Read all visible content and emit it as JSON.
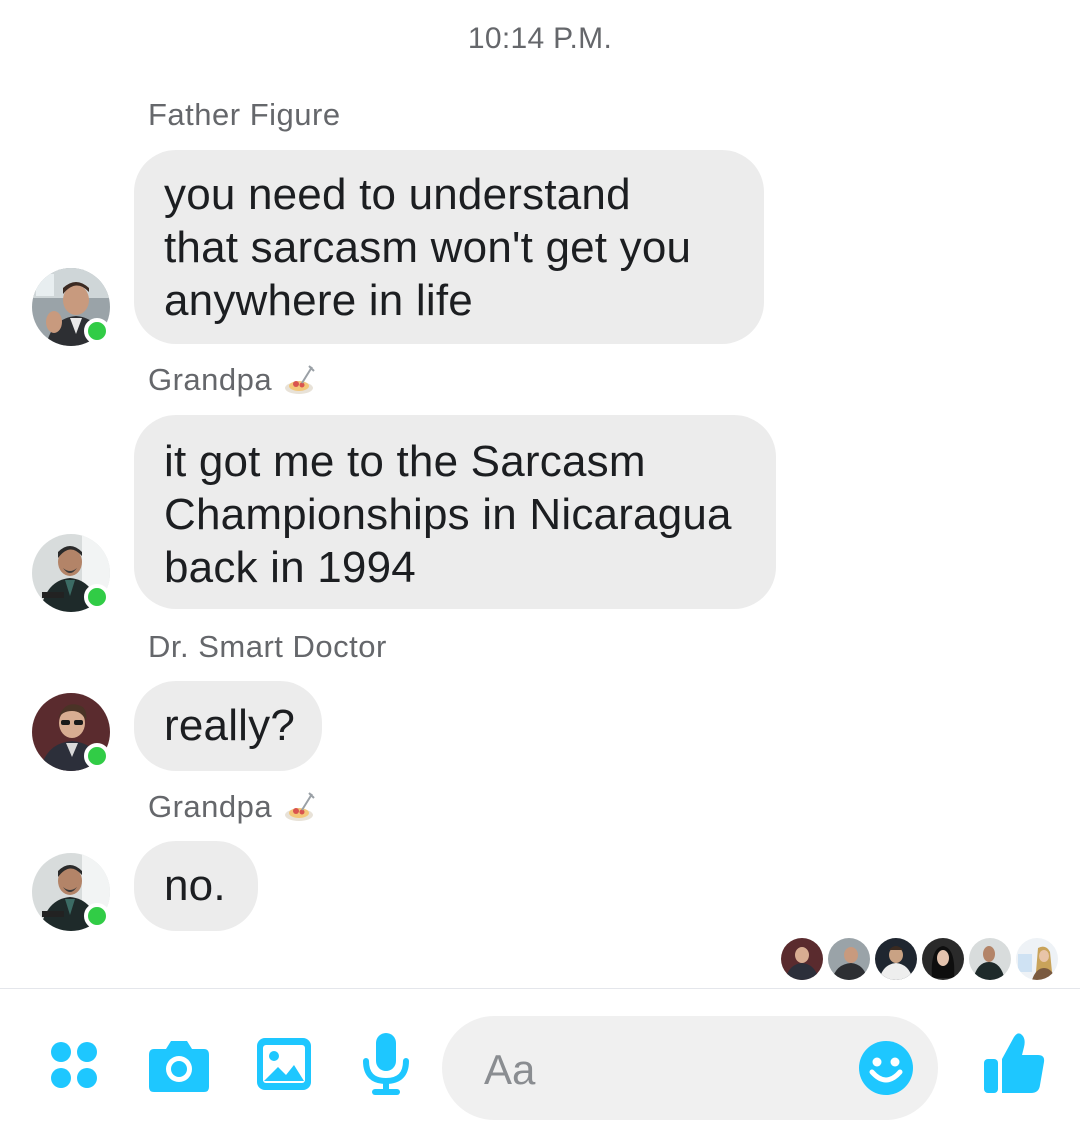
{
  "timestamp": "10:14 P.M.",
  "messages": [
    {
      "sender": "Father Figure",
      "sender_emoji": "",
      "lines": [
        "you need to understand",
        "that sarcasm won't get you",
        "anywhere in life"
      ]
    },
    {
      "sender": "Grandpa",
      "sender_emoji": "spaghetti-emoji",
      "lines": [
        "it got me to the Sarcasm",
        "Championships in Nicaragua",
        "back in 1994"
      ]
    },
    {
      "sender": "Dr. Smart Doctor",
      "sender_emoji": "",
      "lines": [
        "really?"
      ]
    },
    {
      "sender": "Grandpa",
      "sender_emoji": "spaghetti-emoji",
      "lines": [
        "no."
      ]
    }
  ],
  "read_receipts_count": 6,
  "composer": {
    "placeholder": "Aa",
    "icons": [
      "more-actions-icon",
      "camera-icon",
      "gallery-icon",
      "microphone-icon",
      "emoji-icon",
      "thumbs-up-icon"
    ]
  },
  "colors": {
    "accent": "#1ec7ff",
    "bubble": "#ececec",
    "online": "#31cc46",
    "muted_text": "#65676b"
  }
}
